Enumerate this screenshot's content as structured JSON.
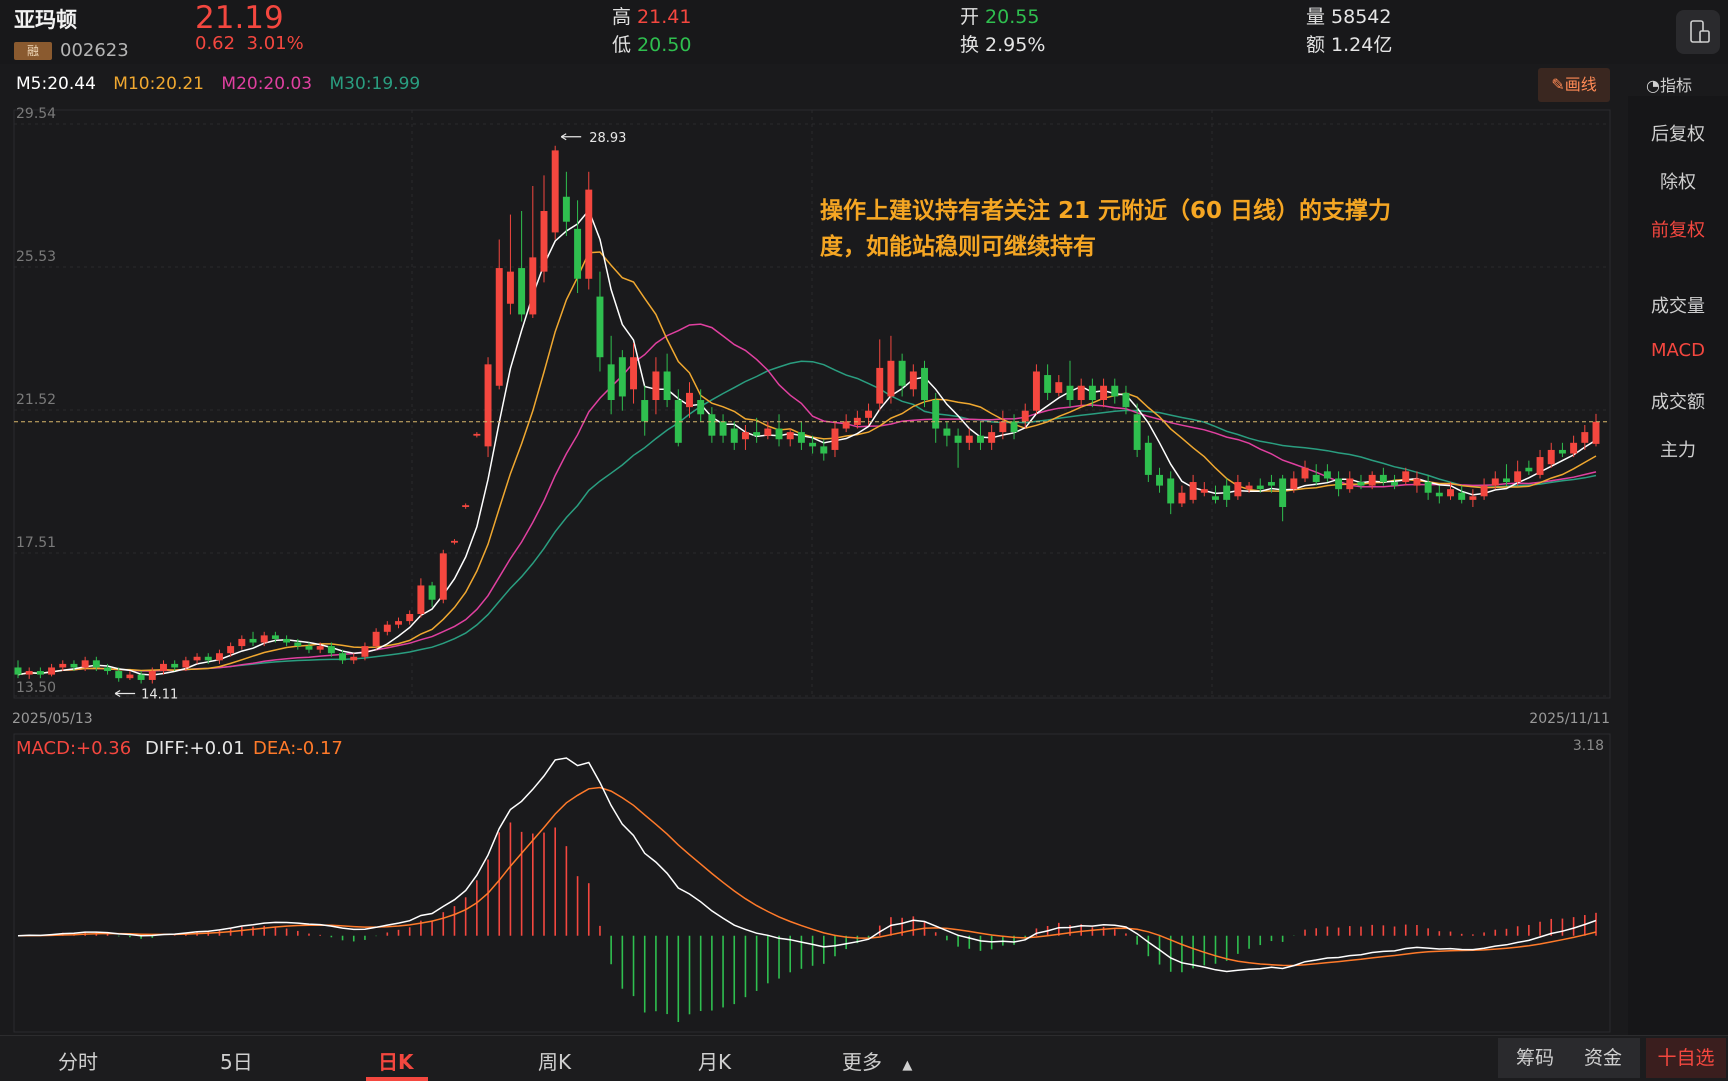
{
  "header": {
    "name": "亚玛顿",
    "rong": "融",
    "code": "002623",
    "price": "21.19",
    "change": "0.62",
    "change_pct": "3.01%",
    "high_label": "高",
    "high": "21.41",
    "low_label": "低",
    "low": "20.50",
    "open_label": "开",
    "open": "20.55",
    "turnover_label": "换",
    "turnover": "2.95%",
    "volume_label": "量",
    "volume": "58542",
    "amount_label": "额",
    "amount": "1.24亿"
  },
  "ma": {
    "m5": "M5:20.44",
    "m10": "M10:20.21",
    "m20": "M20:20.03",
    "m30": "M30:19.99"
  },
  "toolbar": {
    "draw": "✎画线",
    "indicator": "◔指标"
  },
  "side": [
    "后复权",
    "除权",
    "前复权",
    "成交量",
    "MACD",
    "成交额",
    "主力"
  ],
  "side_active": [
    "前复权",
    "MACD"
  ],
  "tabs": [
    "分时",
    "5日",
    "日K",
    "周K",
    "月K",
    "更多"
  ],
  "active_tab": "日K",
  "bottom_buttons": {
    "chips": "筹码",
    "funds": "资金",
    "add": "十自选"
  },
  "colors": {
    "up": "#f4473f",
    "down": "#2fbf4f",
    "ma5": "#ffffff",
    "ma10": "#f0a830",
    "ma20": "#e040a0",
    "ma30": "#2a9e80",
    "dea": "#ff7a2a",
    "accent_text": "#f5a623"
  },
  "chart_data": {
    "type": "candlestick",
    "title": "",
    "annotation": "操作上建议持有者关注 21 元附近（60 日线）的支撑力度，如能站稳则可继续持有",
    "y_ticks": [
      "29.54",
      "25.53",
      "21.52",
      "17.51",
      "13.50"
    ],
    "ylim": [
      13.5,
      29.54
    ],
    "x_labels": [
      "2025/05/13",
      "2025/11/11"
    ],
    "max_label": "28.93",
    "min_label": "14.11",
    "last_close": 21.19,
    "candles": [
      [
        14.3,
        14.1,
        14.5,
        14.0
      ],
      [
        14.1,
        14.2,
        14.3,
        13.98
      ],
      [
        14.2,
        14.1,
        14.3,
        14.0
      ],
      [
        14.1,
        14.3,
        14.4,
        14.05
      ],
      [
        14.3,
        14.4,
        14.5,
        14.2
      ],
      [
        14.4,
        14.3,
        14.5,
        14.2
      ],
      [
        14.3,
        14.5,
        14.6,
        14.2
      ],
      [
        14.5,
        14.3,
        14.6,
        14.2
      ],
      [
        14.3,
        14.2,
        14.4,
        14.1
      ],
      [
        14.2,
        14.0,
        14.3,
        13.9
      ],
      [
        14.0,
        14.1,
        14.2,
        13.95
      ],
      [
        14.1,
        13.95,
        14.2,
        13.85
      ],
      [
        13.95,
        14.2,
        14.3,
        13.85
      ],
      [
        14.2,
        14.4,
        14.5,
        14.1
      ],
      [
        14.4,
        14.3,
        14.5,
        14.2
      ],
      [
        14.3,
        14.5,
        14.6,
        14.2
      ],
      [
        14.5,
        14.6,
        14.7,
        14.4
      ],
      [
        14.6,
        14.5,
        14.7,
        14.4
      ],
      [
        14.5,
        14.7,
        14.8,
        14.4
      ],
      [
        14.7,
        14.9,
        15.0,
        14.6
      ],
      [
        14.9,
        15.1,
        15.2,
        14.8
      ],
      [
        15.1,
        15.0,
        15.3,
        14.9
      ],
      [
        15.0,
        15.2,
        15.3,
        14.9
      ],
      [
        15.2,
        15.1,
        15.3,
        15.0
      ],
      [
        15.1,
        15.0,
        15.2,
        14.9
      ],
      [
        15.0,
        14.9,
        15.1,
        14.8
      ],
      [
        14.9,
        14.8,
        15.0,
        14.7
      ],
      [
        14.8,
        14.9,
        15.0,
        14.7
      ],
      [
        14.9,
        14.7,
        15.0,
        14.6
      ],
      [
        14.7,
        14.5,
        14.8,
        14.4
      ],
      [
        14.5,
        14.6,
        14.7,
        14.4
      ],
      [
        14.6,
        14.9,
        15.0,
        14.5
      ],
      [
        14.9,
        15.3,
        15.4,
        14.8
      ],
      [
        15.3,
        15.5,
        15.6,
        15.2
      ],
      [
        15.5,
        15.6,
        15.7,
        15.4
      ],
      [
        15.6,
        15.8,
        15.9,
        15.5
      ],
      [
        15.8,
        16.6,
        16.8,
        15.7
      ],
      [
        16.6,
        16.2,
        16.7,
        16.0
      ],
      [
        16.2,
        17.5,
        17.6,
        16.1
      ],
      [
        17.8,
        17.85,
        17.9,
        17.75
      ],
      [
        18.8,
        18.85,
        18.9,
        18.75
      ],
      [
        20.8,
        20.85,
        20.9,
        20.75
      ],
      [
        20.5,
        22.8,
        23.0,
        20.2
      ],
      [
        22.2,
        25.5,
        26.3,
        22.1
      ],
      [
        24.5,
        25.4,
        27.0,
        24.2
      ],
      [
        25.5,
        24.2,
        27.1,
        24.0
      ],
      [
        24.2,
        25.8,
        27.8,
        24.1
      ],
      [
        25.4,
        27.1,
        28.1,
        25.1
      ],
      [
        26.5,
        28.8,
        28.93,
        26.3
      ],
      [
        27.5,
        26.8,
        28.2,
        26.4
      ],
      [
        26.6,
        25.2,
        27.4,
        24.8
      ],
      [
        25.2,
        27.7,
        28.2,
        24.9
      ],
      [
        24.7,
        23.0,
        25.4,
        22.6
      ],
      [
        22.8,
        21.8,
        23.6,
        21.4
      ],
      [
        23.0,
        21.9,
        23.2,
        21.5
      ],
      [
        22.1,
        23.0,
        23.4,
        21.7
      ],
      [
        21.8,
        21.2,
        22.2,
        20.8
      ],
      [
        21.8,
        22.6,
        23.0,
        21.4
      ],
      [
        22.6,
        21.8,
        23.1,
        21.6
      ],
      [
        21.8,
        20.6,
        22.1,
        20.5
      ],
      [
        21.6,
        22.0,
        22.3,
        21.3
      ],
      [
        21.8,
        21.4,
        22.1,
        21.2
      ],
      [
        21.4,
        20.8,
        21.6,
        20.6
      ],
      [
        21.2,
        20.8,
        21.4,
        20.6
      ],
      [
        21.0,
        20.6,
        21.2,
        20.4
      ],
      [
        20.7,
        20.9,
        21.1,
        20.4
      ],
      [
        20.9,
        20.8,
        21.3,
        20.6
      ],
      [
        20.8,
        21.0,
        21.2,
        20.7
      ],
      [
        21.0,
        20.7,
        21.4,
        20.5
      ],
      [
        20.7,
        20.9,
        21.0,
        20.5
      ],
      [
        20.9,
        20.6,
        21.2,
        20.4
      ],
      [
        20.6,
        20.5,
        20.8,
        20.3
      ],
      [
        20.5,
        20.3,
        20.7,
        20.1
      ],
      [
        20.4,
        21.0,
        21.2,
        20.2
      ],
      [
        21.0,
        21.2,
        21.4,
        20.9
      ],
      [
        21.1,
        21.3,
        21.5,
        21.0
      ],
      [
        21.3,
        21.5,
        21.7,
        21.1
      ],
      [
        21.7,
        22.7,
        23.5,
        21.5
      ],
      [
        21.9,
        22.9,
        23.6,
        21.7
      ],
      [
        22.9,
        22.2,
        23.1,
        21.9
      ],
      [
        22.1,
        22.6,
        22.8,
        21.9
      ],
      [
        22.7,
        21.8,
        22.9,
        21.6
      ],
      [
        21.8,
        21.0,
        22.0,
        20.6
      ],
      [
        21.0,
        20.8,
        21.2,
        20.5
      ],
      [
        20.8,
        20.6,
        21.0,
        19.9
      ],
      [
        20.6,
        20.8,
        21.0,
        20.4
      ],
      [
        20.8,
        20.6,
        21.2,
        20.4
      ],
      [
        20.6,
        20.9,
        21.1,
        20.4
      ],
      [
        20.9,
        21.2,
        21.5,
        20.7
      ],
      [
        21.2,
        20.9,
        21.4,
        20.7
      ],
      [
        21.2,
        21.5,
        21.7,
        21.0
      ],
      [
        21.5,
        22.6,
        22.8,
        21.4
      ],
      [
        22.5,
        22.0,
        22.8,
        21.8
      ],
      [
        22.0,
        22.3,
        22.5,
        21.9
      ],
      [
        22.2,
        21.8,
        22.9,
        21.6
      ],
      [
        21.8,
        22.2,
        22.4,
        21.6
      ],
      [
        22.2,
        21.8,
        22.4,
        21.6
      ],
      [
        21.8,
        22.2,
        22.4,
        21.6
      ],
      [
        22.2,
        21.9,
        22.4,
        21.7
      ],
      [
        22.0,
        21.6,
        22.2,
        21.4
      ],
      [
        21.4,
        20.4,
        21.7,
        20.2
      ],
      [
        20.6,
        19.7,
        20.8,
        19.5
      ],
      [
        19.7,
        19.4,
        19.9,
        19.2
      ],
      [
        19.6,
        18.9,
        19.8,
        18.6
      ],
      [
        18.9,
        19.2,
        19.4,
        18.8
      ],
      [
        19.0,
        19.5,
        19.7,
        18.9
      ],
      [
        19.2,
        19.3,
        19.5,
        19.1
      ],
      [
        19.1,
        19.0,
        19.4,
        18.9
      ],
      [
        19.4,
        19.0,
        19.6,
        18.8
      ],
      [
        19.1,
        19.5,
        19.7,
        19.0
      ],
      [
        19.3,
        19.4,
        19.5,
        19.2
      ],
      [
        19.4,
        19.3,
        19.6,
        19.2
      ],
      [
        19.5,
        19.4,
        19.7,
        19.2
      ],
      [
        19.6,
        18.8,
        19.7,
        18.4
      ],
      [
        19.3,
        19.6,
        19.8,
        19.2
      ],
      [
        19.6,
        19.9,
        20.1,
        19.5
      ],
      [
        19.7,
        19.5,
        20.0,
        19.4
      ],
      [
        19.8,
        19.6,
        20.0,
        19.5
      ],
      [
        19.6,
        19.3,
        19.8,
        19.1
      ],
      [
        19.3,
        19.6,
        19.8,
        19.2
      ],
      [
        19.5,
        19.4,
        19.7,
        19.3
      ],
      [
        19.4,
        19.7,
        19.8,
        19.3
      ],
      [
        19.7,
        19.5,
        19.9,
        19.4
      ],
      [
        19.5,
        19.4,
        19.7,
        19.3
      ],
      [
        19.5,
        19.8,
        19.9,
        19.4
      ],
      [
        19.4,
        19.6,
        19.8,
        19.2
      ],
      [
        19.5,
        19.2,
        19.7,
        19.0
      ],
      [
        19.2,
        19.1,
        19.4,
        18.9
      ],
      [
        19.1,
        19.3,
        19.5,
        19.0
      ],
      [
        19.2,
        19.0,
        19.4,
        18.9
      ],
      [
        19.0,
        19.1,
        19.3,
        18.8
      ],
      [
        19.1,
        19.4,
        19.6,
        19.0
      ],
      [
        19.4,
        19.6,
        19.8,
        19.3
      ],
      [
        19.6,
        19.5,
        20.0,
        19.4
      ],
      [
        19.5,
        19.8,
        20.1,
        19.4
      ],
      [
        19.9,
        19.8,
        20.1,
        19.7
      ],
      [
        19.7,
        20.2,
        20.4,
        19.6
      ],
      [
        20.0,
        20.4,
        20.6,
        19.9
      ],
      [
        20.4,
        20.3,
        20.6,
        20.2
      ],
      [
        20.3,
        20.6,
        20.8,
        20.2
      ],
      [
        20.6,
        20.9,
        21.1,
        20.4
      ],
      [
        20.57,
        21.19,
        21.41,
        20.5
      ]
    ],
    "macd": {
      "label": "MACD:+0.36",
      "diff_label": "DIFF:+0.01",
      "dea_label": "DEA:-0.17",
      "ymax_label": "3.18",
      "ylim": [
        -1.5,
        3.18
      ]
    }
  }
}
